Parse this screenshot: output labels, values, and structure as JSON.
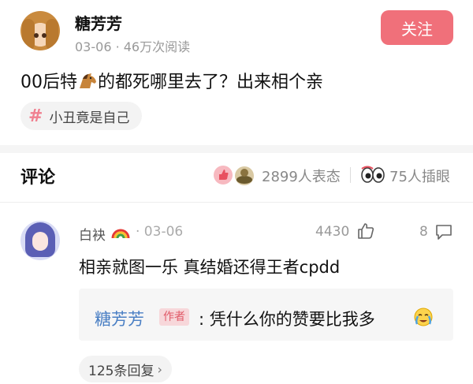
{
  "post": {
    "author": "糖芳芳",
    "meta": "03-06 · 46万次阅读",
    "follow_label": "关注",
    "text_before": "00后特",
    "text_after": "的都死哪里去了？出来相个亲",
    "topic": "小丑竟是自己",
    "topic_hash": "#"
  },
  "comments_header": {
    "title": "评论",
    "reactions": "2899人表态",
    "eyes": "75人插眼"
  },
  "comment": {
    "name": "白袂",
    "meta": "· 03-06",
    "likes": "4430",
    "replies": "8",
    "text": "相亲就图一乐 真结婚还得王者cpdd",
    "reply": {
      "author": "糖芳芳",
      "tag": "作者",
      "text": ": 凭什么你的赞要比我多"
    },
    "more_replies": "125条回复",
    "more_chevron": "›"
  },
  "colors": {
    "follow_bg": "#f0707a",
    "author_link": "#4a7fc4",
    "hash": "#f08090"
  }
}
